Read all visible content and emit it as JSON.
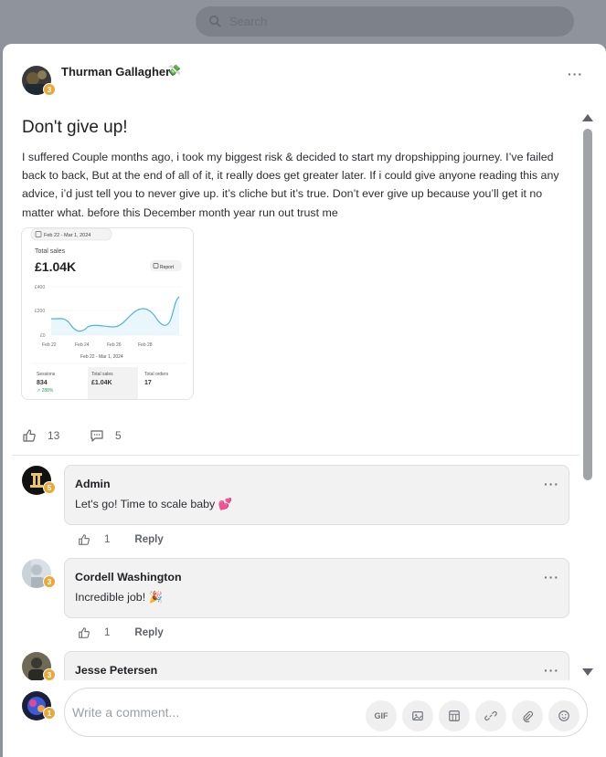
{
  "search": {
    "placeholder": "Search"
  },
  "post": {
    "author": "Thurman Gallagher",
    "author_emoji": "💸",
    "author_level": "3",
    "title": "Don't give up!",
    "body": "I suffered Couple months ago, i took my biggest risk & decided to start my dropshipping journey. I’ve failed back to back, But at the end of all of it, it really does get greater later. If i could give anyone reading this any advice, i’d just tell you to never give up. it’s cliche but it’s true. Don’t ever give up because you’ll get it no matter what. before this December month year run out trust me",
    "likes": "13",
    "comments": "5",
    "menu": "···"
  },
  "attachment": {
    "date_range": "Feb 22 - Mar 1, 2024",
    "metric_label": "Total sales",
    "metric_value": "£1.04K",
    "report_label": "Report",
    "y_ticks": [
      "£400",
      "£200",
      "£0"
    ],
    "x_ticks": [
      "Feb 22",
      "Feb 24",
      "Feb 26",
      "Feb 28"
    ],
    "caption": "Feb 22 - Mar 1, 2024",
    "sessions_label": "Sessions",
    "sessions_value": "834",
    "sessions_change": "↗ 288%",
    "sales_label": "Total sales",
    "sales_value": "£1.04K",
    "orders_label": "Total orders",
    "orders_value": "17"
  },
  "comments": [
    {
      "name": "Admin",
      "level": "5",
      "text": "Let's go! Time to scale baby 💕",
      "likes": "1",
      "reply": "Reply",
      "menu": "···"
    },
    {
      "name": "Cordell Washington",
      "level": "3",
      "text": "Incredible job! 🎉",
      "likes": "1",
      "reply": "Reply",
      "menu": "···"
    },
    {
      "name": "Jesse Petersen",
      "level": "3",
      "menu": "···"
    }
  ],
  "composer": {
    "placeholder": "Write a comment...",
    "gif_label": "GIF",
    "user_level": "1"
  },
  "colors": {
    "accent_level": "#e8a93a",
    "chart_line": "#4fb3d9",
    "positive": "#2e9e5b"
  }
}
